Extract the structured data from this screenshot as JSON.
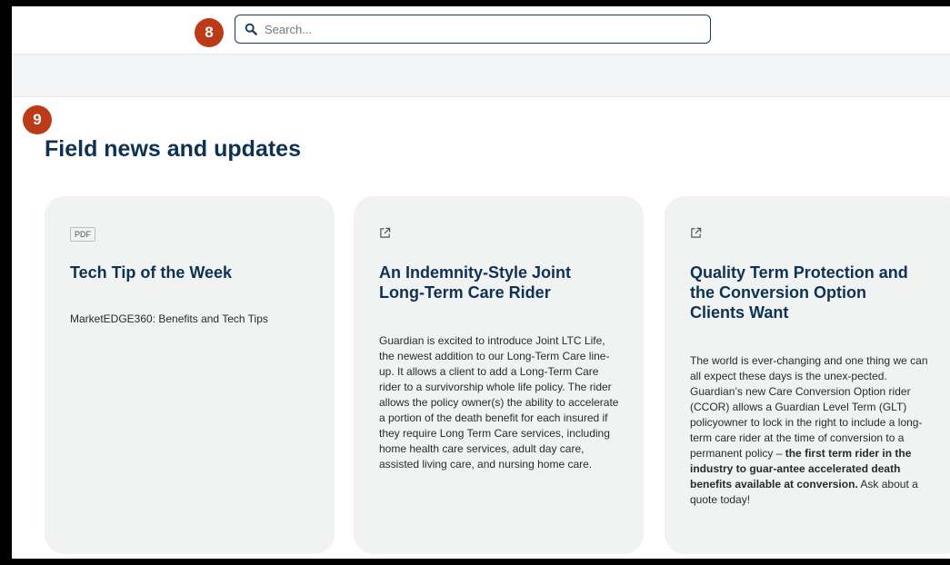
{
  "markers": {
    "search_marker": "8",
    "section_marker": "9"
  },
  "search": {
    "placeholder": "Search..."
  },
  "section": {
    "title": "Field news and updates"
  },
  "cards": [
    {
      "badge": "PDF",
      "title": "Tech Tip of the Week",
      "body": "MarketEDGE360: Benefits and Tech Tips"
    },
    {
      "icon": "external-link-icon",
      "title": "An Indemnity-Style Joint Long-Term Care Rider",
      "body": "Guardian is excited to introduce Joint LTC Life, the newest addition to our Long-Term Care line-up. It allows a client to add a Long-Term Care rider to a survivorship whole life policy. The rider allows the policy owner(s) the ability to accelerate a portion of the death benefit for each insured if they require Long Term Care services, including home health care services, adult day care, assisted living care, and nursing home care."
    },
    {
      "icon": "external-link-icon",
      "title": "Quality Term Protection and the Conversion Option Clients Want",
      "body_intro": "The world is ever-changing and one thing we can all expect these days is the unex-pected. Guardian’s new Care Conversion Option rider (CCOR) allows a Guardian Level Term (GLT) policyowner to lock in the right to include a long-term care rider at the time of conversion to a permanent policy –",
      "body_bold": "the first term rider in the industry to guar-antee accelerated death benefits available at conversion.",
      "body_tail": "Ask about a quote today!"
    }
  ],
  "colors": {
    "marker": "#bd3a18",
    "heading": "#0e3253",
    "card_bg": "#f1f3f3"
  }
}
